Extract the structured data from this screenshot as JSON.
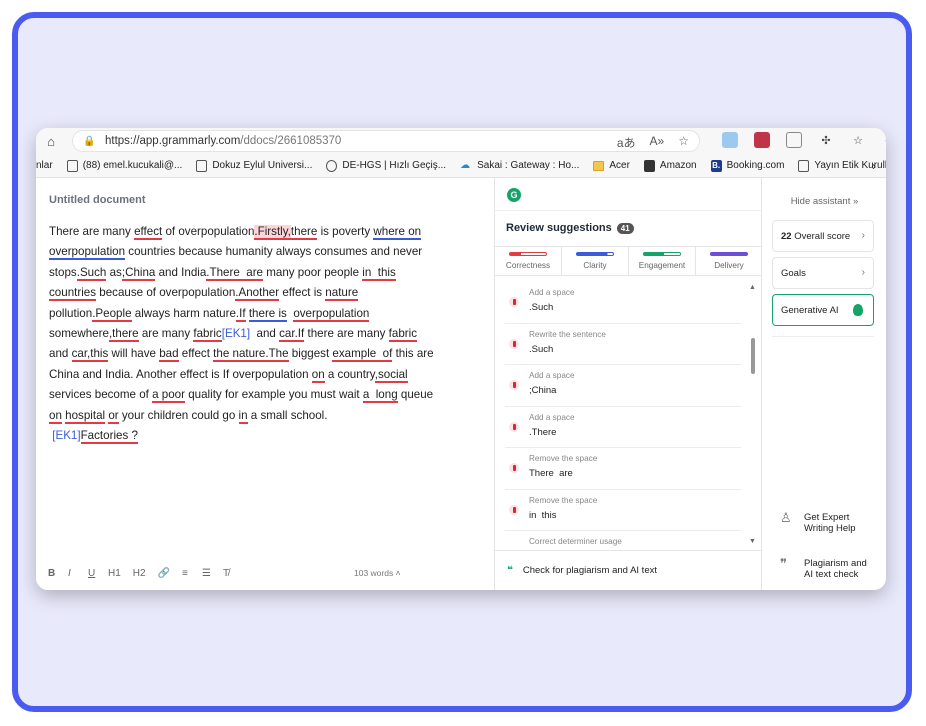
{
  "browser": {
    "url_host": "https://app.grammarly.com",
    "url_path": "/ddocs/2661085370",
    "url_icons": [
      "aあ",
      "A»",
      "☆"
    ],
    "bookmarks": [
      {
        "label": "nlar",
        "icon": "none"
      },
      {
        "label": "(88) emel.kucukali@...",
        "icon": "page"
      },
      {
        "label": "Dokuz Eylul Universi...",
        "icon": "page"
      },
      {
        "label": "DE-HGS | Hızlı Geçiş...",
        "icon": "globe"
      },
      {
        "label": "Sakai : Gateway : Ho...",
        "icon": "sakai"
      },
      {
        "label": "Acer",
        "icon": "folder"
      },
      {
        "label": "Amazon",
        "icon": "amz"
      },
      {
        "label": "Booking.com",
        "icon": "bk"
      },
      {
        "label": "Yayın Etik Kurulları |...",
        "icon": "page"
      }
    ]
  },
  "editor": {
    "title": "Untitled document",
    "word_count": "103 words",
    "toolbar": [
      "B",
      "I",
      "U",
      "H1",
      "H2",
      "🔗",
      "≡",
      "☰",
      "T̸"
    ]
  },
  "assistant": {
    "logo": "G",
    "review_title": "Review suggestions",
    "review_count": "41",
    "categories": [
      {
        "label": "Correctness",
        "color": "#e63946"
      },
      {
        "label": "Clarity",
        "color": "#3b5bdb"
      },
      {
        "label": "Engagement",
        "color": "#14a46a"
      },
      {
        "label": "Delivery",
        "color": "#6d4ed8"
      }
    ],
    "suggestions": [
      {
        "label": "Add a space",
        "value": ".Such"
      },
      {
        "label": "Rewrite the sentence",
        "value": ".Such"
      },
      {
        "label": "Add a space",
        "value": ";China"
      },
      {
        "label": "Add a space",
        "value": ".There"
      },
      {
        "label": "Remove the space",
        "value": "There  are"
      },
      {
        "label": "Remove the space",
        "value": "in  this"
      },
      {
        "label": "Correct determiner usage",
        "value": ""
      }
    ],
    "plagiarism": "Check for plagiarism and AI text"
  },
  "side": {
    "hide": "Hide assistant",
    "score_value": "22",
    "score_label": "Overall score",
    "goals": "Goals",
    "genai": "Generative AI",
    "expert": "Get Expert Writing Help",
    "plag": "Plagiarism and AI text check"
  }
}
